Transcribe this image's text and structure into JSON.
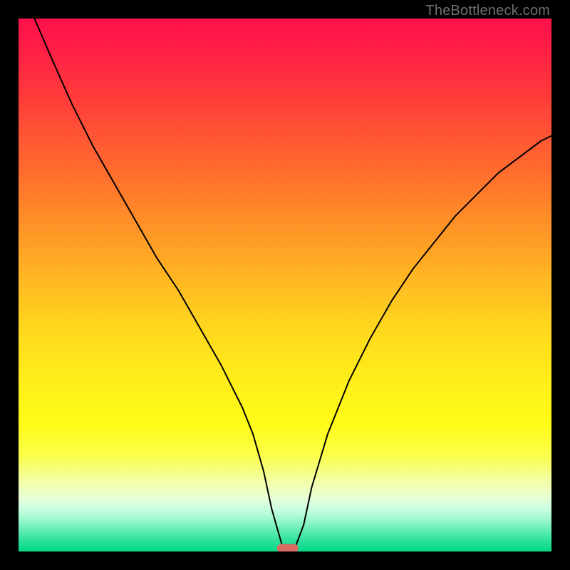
{
  "watermark": {
    "text": "TheBottleneck.com"
  },
  "chart_data": {
    "type": "line",
    "title": "",
    "xlabel": "",
    "ylabel": "",
    "xlim": [
      0,
      100
    ],
    "ylim": [
      0,
      100
    ],
    "grid": false,
    "legend": false,
    "background": {
      "type": "vertical-gradient",
      "description": "red→orange→yellow→green bottleneck-severity gradient (top = 100 / worst, bottom = 0 / best)"
    },
    "series": [
      {
        "name": "bottleneck-curve",
        "color": "#000000",
        "x": [
          3,
          6,
          10,
          14,
          18,
          22,
          26,
          30,
          34,
          38,
          42,
          44,
          46,
          47.5,
          49.5,
          52,
          53.5,
          55,
          58,
          62,
          66,
          70,
          74,
          78,
          82,
          86,
          90,
          94,
          98,
          100
        ],
        "y": [
          100,
          93,
          84,
          76,
          69,
          62,
          55,
          49,
          42,
          35,
          27,
          22,
          15,
          8,
          1,
          1,
          5,
          12,
          22,
          32,
          40,
          47,
          53,
          58,
          63,
          67,
          71,
          74,
          77,
          78
        ]
      }
    ],
    "marker": {
      "name": "optimal-point",
      "shape": "rounded-rect",
      "color": "#d96b61",
      "x": 50.5,
      "y": 0.6,
      "width_x_units": 4.0,
      "height_y_units": 1.6
    }
  }
}
